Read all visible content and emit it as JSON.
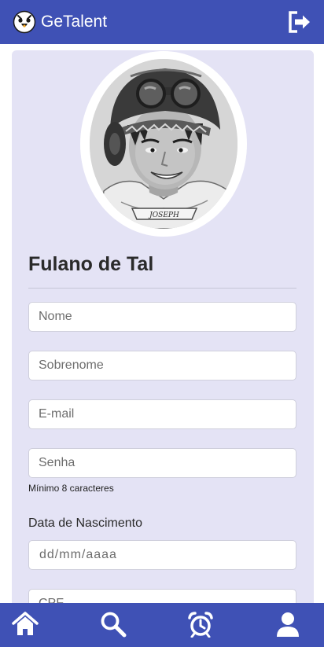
{
  "header": {
    "app_name": "GeTalent",
    "logo_icon": "retro-robot-logo-icon",
    "logout_icon": "logout-icon",
    "background_color": "#3f51b5"
  },
  "profile": {
    "display_name": "Fulano de Tal",
    "portrait_label": "JOSEPH"
  },
  "form": {
    "first_name_placeholder": "Nome",
    "last_name_placeholder": "Sobrenome",
    "email_placeholder": "E-mail",
    "password_placeholder": "Senha",
    "password_hint": "Mínimo 8 caracteres",
    "birth_date_label": "Data de Nascimento",
    "birth_date_placeholder": "dd/mm/aaaa",
    "cpf_placeholder": "CPF"
  },
  "bottom_nav": [
    {
      "icon": "home-icon"
    },
    {
      "icon": "search-icon"
    },
    {
      "icon": "alarm-clock-icon"
    },
    {
      "icon": "user-icon"
    }
  ],
  "colors": {
    "primary": "#3f51b5",
    "card_background": "#e4e3f5"
  }
}
